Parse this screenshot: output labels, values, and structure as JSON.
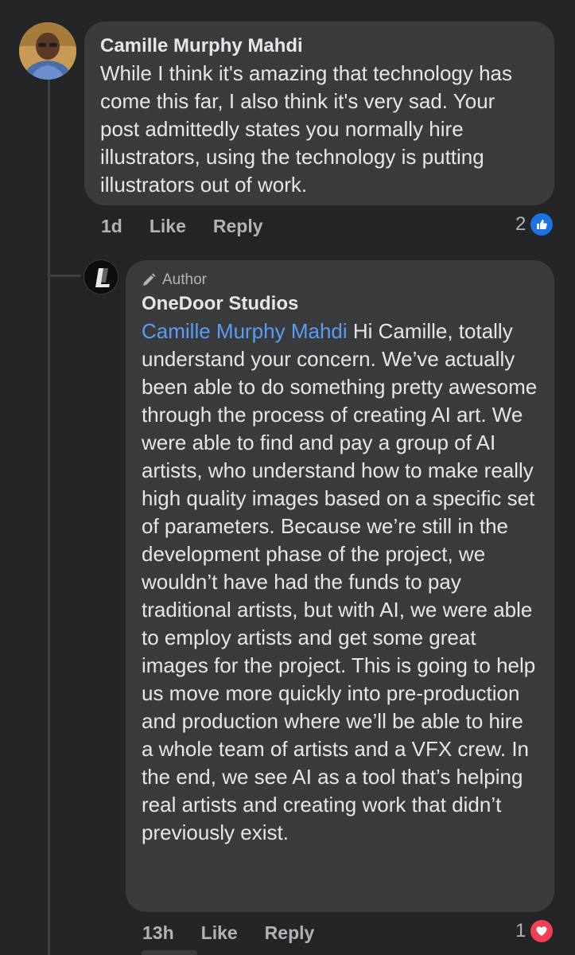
{
  "comment": {
    "author": "Camille Murphy Mahdi",
    "text": "While I think it's amazing that technology has come this far, I also think it's very sad. Your post admittedly states you normally hire illustrators, using the technology is putting illustrators out of work.",
    "time": "1d",
    "like_label": "Like",
    "reply_label": "Reply",
    "reaction_count": "2",
    "reaction_icon": "like-icon"
  },
  "reply": {
    "badge": "Author",
    "badge_icon": "pencil-icon",
    "author": "OneDoor Studios",
    "mention": "Camille Murphy Mahdi",
    "text": " Hi Camille, totally understand your concern. We’ve actually been able to do something pretty awesome through the process of creating AI art. We were able to find and pay a group of AI artists, who understand how to make really high quality images based on a specific set of parameters. Because we’re still in the development phase of the project, we wouldn’t have had the funds to pay traditional artists, but with AI, we were able to employ artists and get some great images for the project. This is going to help us move more quickly into pre-production and production where we’ll be able to hire a whole team of artists and a VFX crew. In the end, we see AI as a tool that’s helping real artists and creating work that didn’t previously exist.",
    "time": "13h",
    "like_label": "Like",
    "reply_label": "Reply",
    "reaction_count": "1",
    "reaction_icon": "love-icon"
  },
  "colors": {
    "background": "#242526",
    "bubble": "#3a3b3c",
    "mention": "#5b9cf5",
    "like_blue": "#1b74e4",
    "love_red": "#f33e58"
  }
}
